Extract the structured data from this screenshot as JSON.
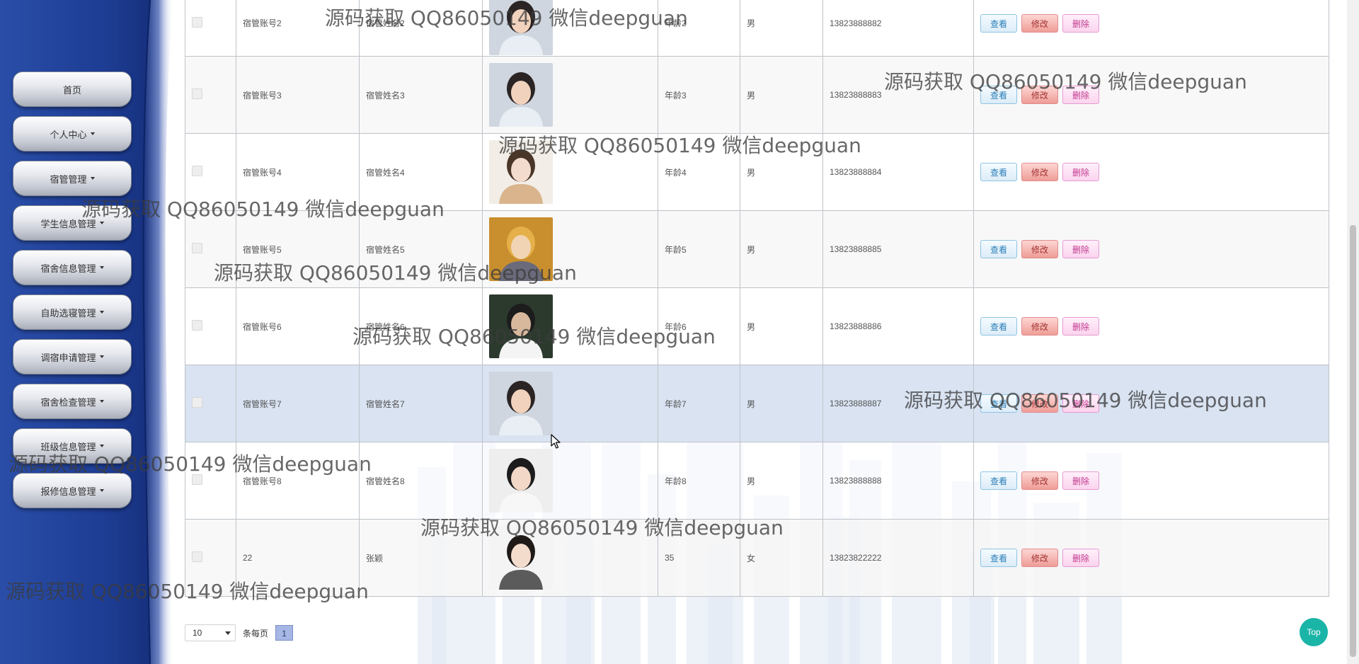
{
  "sidebar": {
    "items": [
      {
        "label": "首页",
        "has_caret": false
      },
      {
        "label": "个人中心",
        "has_caret": true
      },
      {
        "label": "宿管管理",
        "has_caret": true
      },
      {
        "label": "学生信息管理",
        "has_caret": true
      },
      {
        "label": "宿舍信息管理",
        "has_caret": true
      },
      {
        "label": "自助选寝管理",
        "has_caret": true
      },
      {
        "label": "调宿申请管理",
        "has_caret": true
      },
      {
        "label": "宿舍检查管理",
        "has_caret": true
      },
      {
        "label": "班级信息管理",
        "has_caret": true
      },
      {
        "label": "报修信息管理",
        "has_caret": true
      }
    ]
  },
  "table": {
    "buttons": {
      "view": "查看",
      "edit": "修改",
      "delete": "删除"
    },
    "rows": [
      {
        "account": "宿管账号2",
        "name": "宿管姓名2",
        "age": "年龄2",
        "gender": "男",
        "phone": "13823888882",
        "photo": "male-portrait"
      },
      {
        "account": "宿管账号3",
        "name": "宿管姓名3",
        "age": "年龄3",
        "gender": "男",
        "phone": "13823888883",
        "photo": "male-portrait"
      },
      {
        "account": "宿管账号4",
        "name": "宿管姓名4",
        "age": "年龄4",
        "gender": "男",
        "phone": "13823888884",
        "photo": "female-portrait-with-dog"
      },
      {
        "account": "宿管账号5",
        "name": "宿管姓名5",
        "age": "年龄5",
        "gender": "男",
        "phone": "13823888885",
        "photo": "anime-portrait"
      },
      {
        "account": "宿管账号6",
        "name": "宿管姓名6",
        "age": "年龄6",
        "gender": "男",
        "phone": "13823888886",
        "photo": "male-reading-portrait"
      },
      {
        "account": "宿管账号7",
        "name": "宿管姓名7",
        "age": "年龄7",
        "gender": "男",
        "phone": "13823888887",
        "photo": "male-portrait"
      },
      {
        "account": "宿管账号8",
        "name": "宿管姓名8",
        "age": "年龄8",
        "gender": "男",
        "phone": "13823888888",
        "photo": "female-portrait-cap"
      },
      {
        "account": "22",
        "name": "张颖",
        "age": "35",
        "gender": "女",
        "phone": "13823822222",
        "photo": "female-portrait"
      }
    ]
  },
  "pager": {
    "page_size": "10",
    "per_page_label": "条每页",
    "current_page": "1"
  },
  "top_button": "Top",
  "watermark": "源码获取 QQ86050149 微信deepguan",
  "colors": {
    "sidebar_blue": "#1e3f95",
    "hover_row": "#d9e3f2",
    "top_button": "#1bb5a8",
    "view_button": "#2a7fb8",
    "edit_button": "#ef9d97",
    "delete_button": "#c2398f"
  }
}
